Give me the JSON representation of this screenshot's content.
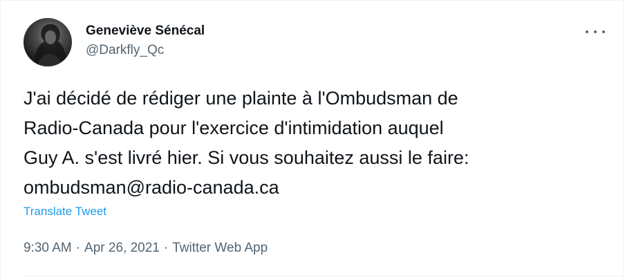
{
  "author": {
    "display_name": "Geneviève Sénécal",
    "handle": "@Darkfly_Qc",
    "avatar_icon": "profile-photo"
  },
  "more_icon": "more-horizontal-icon",
  "tweet": {
    "text": "J'ai décidé de rédiger une plainte à l'Ombudsman de\nRadio-Canada pour l'exercice d'intimidation auquel\nGuy A. s'est livré hier. Si vous souhaitez aussi le faire:\nombudsman@radio-canada.ca",
    "translate_label": "Translate Tweet"
  },
  "meta": {
    "time": "9:30 AM",
    "separator": "·",
    "date": "Apr 26, 2021",
    "source": "Twitter Web App"
  },
  "colors": {
    "text": "#0f1419",
    "secondary": "#536471",
    "link": "#1d9bf0",
    "border": "#eff3f4"
  }
}
